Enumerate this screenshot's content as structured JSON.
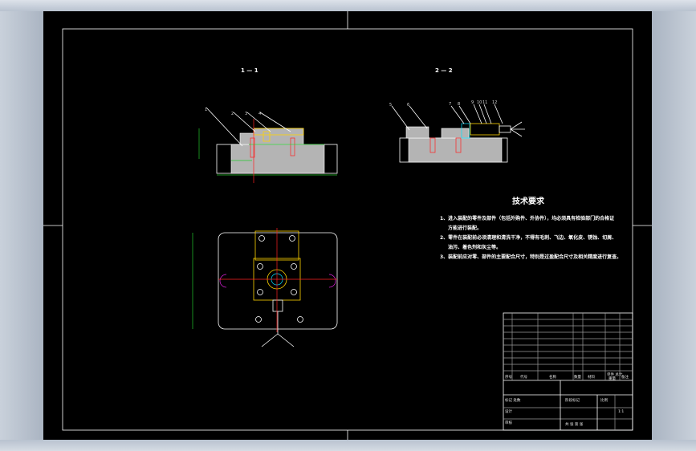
{
  "sections": {
    "a": "1 — 1",
    "b": "2 — 2"
  },
  "balloons": {
    "front": [
      "1",
      "2",
      "3",
      "4"
    ],
    "side": [
      "5",
      "6",
      "7",
      "8",
      "9",
      "10",
      "11",
      "12"
    ]
  },
  "notes": {
    "title": "技术要求",
    "line1": "1、进入装配的零件及部件（包括外购件、外协件），均必须具有检验部门的合格证",
    "line1b": "方能进行装配。",
    "line2": "2、零件在装配前必须清理和清洗干净，不得有毛刺、飞边、氧化皮、锈蚀、切屑、",
    "line2b": "油污、着色剂和灰尘等。",
    "line3": "3、装配前应对零、部件的主要配合尺寸，特别是过盈配合尺寸及相关精度进行复查。"
  },
  "title_block": {
    "col_seq": "序号",
    "col_code": "代号",
    "col_name": "名称",
    "col_qty": "数量",
    "col_material": "材料",
    "col_weight": "单件 总计",
    "col_mass": "重量",
    "col_remark": "备注",
    "row_mark": "标记 处数",
    "row_design": "设计",
    "row_review": "审核",
    "row_stage": "阶段标记",
    "row_scale": "比例",
    "row_sheet": "共 张 第 张",
    "scale_value": "1:1"
  },
  "colors": {
    "background": "#000000",
    "frame": "#ffffff",
    "part_fill": "#b4b4b4",
    "highlight": "#ffd400",
    "dimension": "#24c82c",
    "center": "#ff2020",
    "accent_cyan": "#00e0ff"
  }
}
